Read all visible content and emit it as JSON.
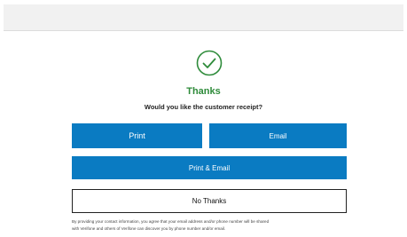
{
  "header": {
    "bar_color": "#f1f1f1"
  },
  "status": {
    "icon": "check-circle-icon",
    "title": "Thanks",
    "question": "Would you like the customer receipt?",
    "accent_color": "#2e8b3a"
  },
  "buttons": {
    "print_label": "Print",
    "email_label": "Email",
    "print_email_label": "Print & Email",
    "no_thanks_label": "No Thanks",
    "primary_color": "#0a7bc2"
  },
  "disclaimer": {
    "line1": "By providing your contact information, you agree that your email address and/or phone number will be shared",
    "line2": "with Verifone and others of Verifone can discover you by phone number and/or email."
  }
}
